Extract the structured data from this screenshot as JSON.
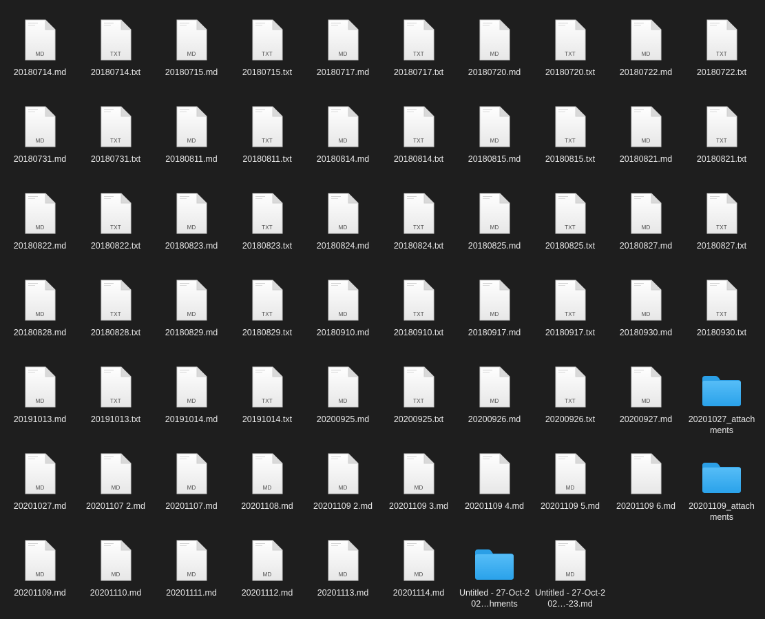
{
  "window": {
    "view": "icon-view"
  },
  "items": [
    {
      "name": "20180714.md",
      "kind": "file",
      "badge": "MD"
    },
    {
      "name": "20180714.txt",
      "kind": "file",
      "badge": "TXT"
    },
    {
      "name": "20180715.md",
      "kind": "file",
      "badge": "MD"
    },
    {
      "name": "20180715.txt",
      "kind": "file",
      "badge": "TXT"
    },
    {
      "name": "20180717.md",
      "kind": "file",
      "badge": "MD"
    },
    {
      "name": "20180717.txt",
      "kind": "file",
      "badge": "TXT"
    },
    {
      "name": "20180720.md",
      "kind": "file",
      "badge": "MD"
    },
    {
      "name": "20180720.txt",
      "kind": "file",
      "badge": "TXT"
    },
    {
      "name": "20180722.md",
      "kind": "file",
      "badge": "MD"
    },
    {
      "name": "20180722.txt",
      "kind": "file",
      "badge": "TXT"
    },
    {
      "name": "20180731.md",
      "kind": "file",
      "badge": "MD"
    },
    {
      "name": "20180731.txt",
      "kind": "file",
      "badge": "TXT"
    },
    {
      "name": "20180811.md",
      "kind": "file",
      "badge": "MD"
    },
    {
      "name": "20180811.txt",
      "kind": "file",
      "badge": "TXT"
    },
    {
      "name": "20180814.md",
      "kind": "file",
      "badge": "MD"
    },
    {
      "name": "20180814.txt",
      "kind": "file",
      "badge": "TXT"
    },
    {
      "name": "20180815.md",
      "kind": "file",
      "badge": "MD"
    },
    {
      "name": "20180815.txt",
      "kind": "file",
      "badge": "TXT"
    },
    {
      "name": "20180821.md",
      "kind": "file",
      "badge": "MD"
    },
    {
      "name": "20180821.txt",
      "kind": "file",
      "badge": "TXT"
    },
    {
      "name": "20180822.md",
      "kind": "file",
      "badge": "MD"
    },
    {
      "name": "20180822.txt",
      "kind": "file",
      "badge": "TXT"
    },
    {
      "name": "20180823.md",
      "kind": "file",
      "badge": "MD"
    },
    {
      "name": "20180823.txt",
      "kind": "file",
      "badge": "TXT"
    },
    {
      "name": "20180824.md",
      "kind": "file",
      "badge": "MD"
    },
    {
      "name": "20180824.txt",
      "kind": "file",
      "badge": "TXT"
    },
    {
      "name": "20180825.md",
      "kind": "file",
      "badge": "MD"
    },
    {
      "name": "20180825.txt",
      "kind": "file",
      "badge": "TXT"
    },
    {
      "name": "20180827.md",
      "kind": "file",
      "badge": "MD"
    },
    {
      "name": "20180827.txt",
      "kind": "file",
      "badge": "TXT"
    },
    {
      "name": "20180828.md",
      "kind": "file",
      "badge": "MD"
    },
    {
      "name": "20180828.txt",
      "kind": "file",
      "badge": "TXT"
    },
    {
      "name": "20180829.md",
      "kind": "file",
      "badge": "MD"
    },
    {
      "name": "20180829.txt",
      "kind": "file",
      "badge": "TXT"
    },
    {
      "name": "20180910.md",
      "kind": "file",
      "badge": "MD"
    },
    {
      "name": "20180910.txt",
      "kind": "file",
      "badge": "TXT"
    },
    {
      "name": "20180917.md",
      "kind": "file",
      "badge": "MD"
    },
    {
      "name": "20180917.txt",
      "kind": "file",
      "badge": "TXT"
    },
    {
      "name": "20180930.md",
      "kind": "file",
      "badge": "MD"
    },
    {
      "name": "20180930.txt",
      "kind": "file",
      "badge": "TXT"
    },
    {
      "name": "20191013.md",
      "kind": "file",
      "badge": "MD"
    },
    {
      "name": "20191013.txt",
      "kind": "file",
      "badge": "TXT"
    },
    {
      "name": "20191014.md",
      "kind": "file",
      "badge": "MD"
    },
    {
      "name": "20191014.txt",
      "kind": "file",
      "badge": "TXT"
    },
    {
      "name": "20200925.md",
      "kind": "file",
      "badge": "MD"
    },
    {
      "name": "20200925.txt",
      "kind": "file",
      "badge": "TXT"
    },
    {
      "name": "20200926.md",
      "kind": "file",
      "badge": "MD"
    },
    {
      "name": "20200926.txt",
      "kind": "file",
      "badge": "TXT"
    },
    {
      "name": "20200927.md",
      "kind": "file",
      "badge": "MD"
    },
    {
      "name": "20201027_attachments",
      "kind": "folder",
      "badge": ""
    },
    {
      "name": "20201027.md",
      "kind": "file",
      "badge": "MD"
    },
    {
      "name": "20201107 2.md",
      "kind": "file",
      "badge": "MD"
    },
    {
      "name": "20201107.md",
      "kind": "file",
      "badge": "MD"
    },
    {
      "name": "20201108.md",
      "kind": "file",
      "badge": "MD"
    },
    {
      "name": "20201109 2.md",
      "kind": "file",
      "badge": "MD"
    },
    {
      "name": "20201109 3.md",
      "kind": "file",
      "badge": "MD"
    },
    {
      "name": "20201109 4.md",
      "kind": "file",
      "badge": ""
    },
    {
      "name": "20201109 5.md",
      "kind": "file",
      "badge": "MD"
    },
    {
      "name": "20201109 6.md",
      "kind": "file",
      "badge": ""
    },
    {
      "name": "20201109_attachments",
      "kind": "folder",
      "badge": ""
    },
    {
      "name": "20201109.md",
      "kind": "file",
      "badge": "MD"
    },
    {
      "name": "20201110.md",
      "kind": "file",
      "badge": "MD"
    },
    {
      "name": "20201111.md",
      "kind": "file",
      "badge": "MD"
    },
    {
      "name": "20201112.md",
      "kind": "file",
      "badge": "MD"
    },
    {
      "name": "20201113.md",
      "kind": "file",
      "badge": "MD"
    },
    {
      "name": "20201114.md",
      "kind": "file",
      "badge": "MD"
    },
    {
      "name": "Untitled - 27-Oct-202…hments",
      "kind": "folder",
      "badge": ""
    },
    {
      "name": "Untitled - 27-Oct-202…-23.md",
      "kind": "file",
      "badge": "MD"
    }
  ],
  "colors": {
    "background": "#1e1e1e",
    "label": "#e6e6e6",
    "folder": "#3aa8f0"
  }
}
